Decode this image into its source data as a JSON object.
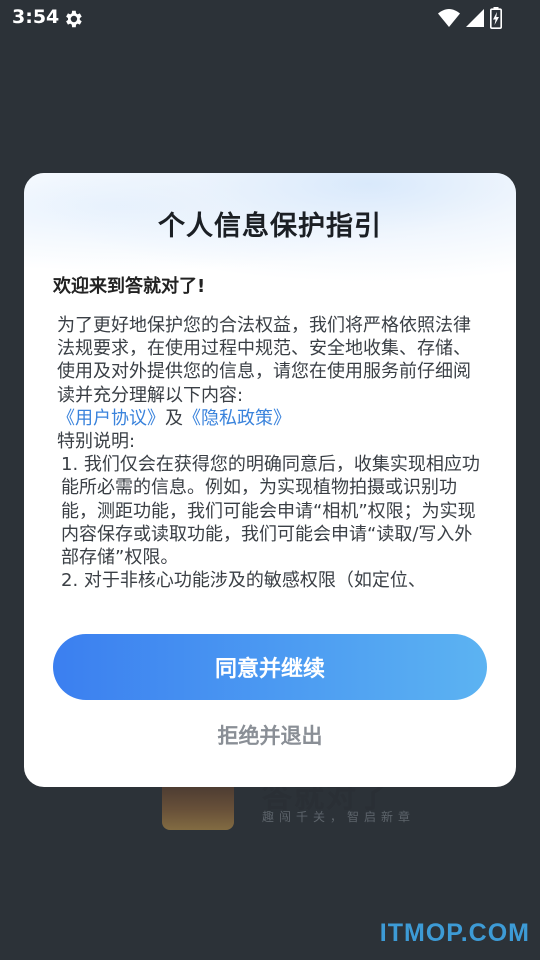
{
  "status_bar": {
    "time": "3:54",
    "icons": [
      "gear-icon",
      "wifi-icon",
      "cell-signal-icon",
      "battery-charging-icon"
    ]
  },
  "background": {
    "app_name": "答就对了",
    "slogan": "趣闯千关，智启新章",
    "watermark": "ITMOP.COM"
  },
  "dialog": {
    "title": "个人信息保护指引",
    "welcome": "欢迎来到答就对了!",
    "intro": "为了更好地保护您的合法权益，我们将严格依照法律法规要求，在使用过程中规范、安全地收集、存储、使用及对外提供您的信息，请您在使用服务前仔细阅读并充分理解以下内容:",
    "user_agreement_link": "《用户协议》",
    "conjunction": "及",
    "privacy_policy_link": "《隐私政策》",
    "special_note_label": "特别说明:",
    "items": [
      "1. 我们仅会在获得您的明确同意后，收集实现相应功能所必需的信息。例如，为实现植物拍摄或识别功能，测距功能，我们可能会申请“相机”权限；为实现内容保存或读取功能，我们可能会申请“读取/写入外部存储”权限。",
      "2. 对于非核心功能涉及的敏感权限（如定位、"
    ],
    "agree_button": "同意并继续",
    "refuse_button": "拒绝并退出"
  },
  "colors": {
    "overlay_bg": "#2c3238",
    "link": "#3a83dc",
    "button_gradient_start": "#3b7ff0",
    "button_gradient_end": "#5cb3f2",
    "refuse_text": "#8a8f96",
    "watermark": "#3d9bd6"
  }
}
